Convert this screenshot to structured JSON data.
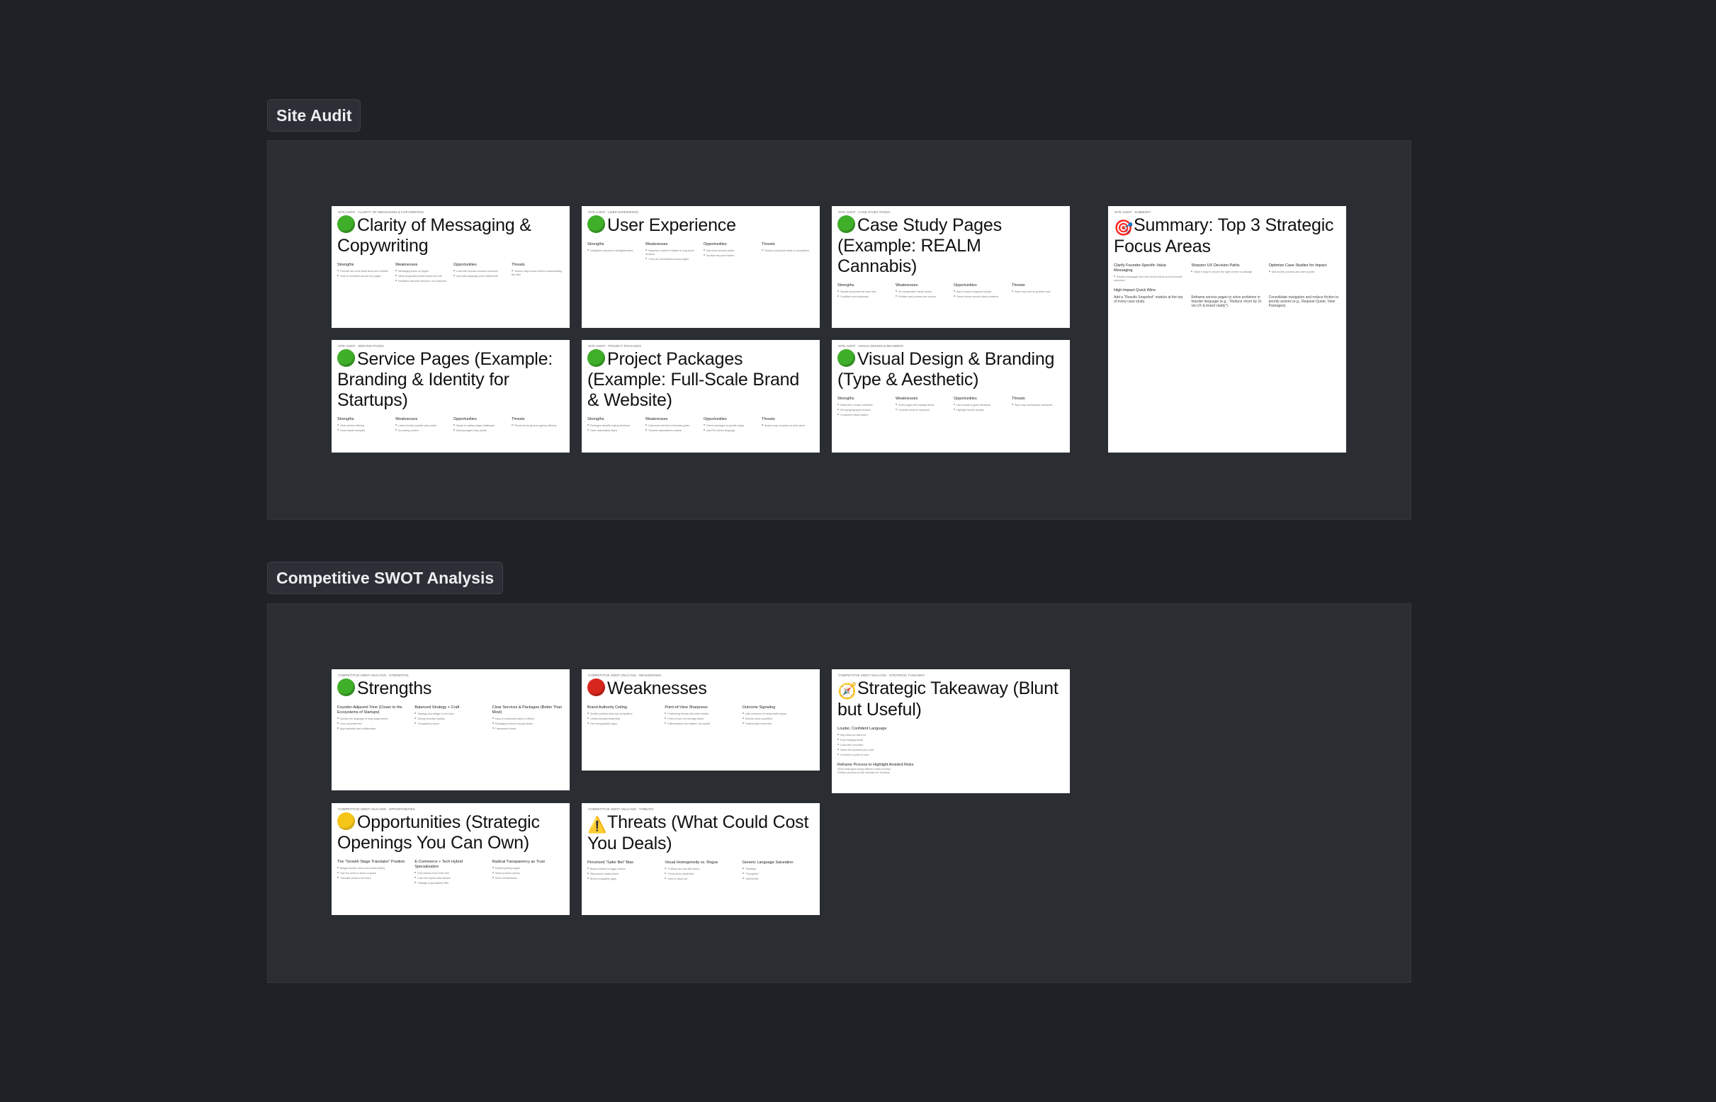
{
  "sections": [
    {
      "label": "Site Audit",
      "slides": [
        {
          "icon": "green-circle-icon",
          "emoji": "",
          "style": "green",
          "breadcrumb": "SITE AUDIT · CLARITY OF MESSAGING & COPYWRITING",
          "title": "Clarity of Messaging & Copywriting",
          "columns": [
            {
              "head": "Strengths",
              "lines": [
                "Founder-led voice feels direct and credible",
                "Tone is consistent across key pages"
              ]
            },
            {
              "head": "Weaknesses",
              "lines": [
                "Messaging leans on jargon",
                "Value proposition buried below the fold",
                "Headlines describe services, not outcomes"
              ]
            },
            {
              "head": "Opportunities",
              "lines": [
                "Lead with founder-focused outcomes",
                "Use plain-language proof statements"
              ]
            },
            {
              "head": "Threats",
              "lines": [
                "Visitors may bounce before understanding the offer"
              ]
            }
          ]
        },
        {
          "icon": "green-circle-icon",
          "emoji": "",
          "style": "green",
          "breadcrumb": "SITE AUDIT · USER EXPERIENCE",
          "title": "User Experience",
          "columns": [
            {
              "head": "Strengths",
              "lines": [
                "Navigation structure is straightforward"
              ]
            },
            {
              "head": "Weaknesses",
              "lines": [
                "Important content is hidden in long scroll sections",
                "CTAs are inconsistent across pages"
              ]
            },
            {
              "head": "Opportunities",
              "lines": [
                "Add clear decision paths",
                "Surface key proof earlier"
              ]
            },
            {
              "head": "Threats",
              "lines": [
                "Friction could push leads to competitors"
              ]
            }
          ]
        },
        {
          "icon": "green-circle-icon",
          "emoji": "",
          "style": "green",
          "breadcrumb": "SITE AUDIT · CASE STUDY PAGES",
          "title": "Case Study Pages (Example: REALM Cannabis)",
          "columns": [
            {
              "head": "Strengths",
              "lines": [
                "Visuals showcase the work well",
                "Credible brand examples"
              ]
            },
            {
              "head": "Weaknesses",
              "lines": [
                "No measurable results shown",
                "Problem and process are unclear"
              ]
            },
            {
              "head": "Opportunities",
              "lines": [
                "Add a results snapshot module",
                "Frame stories around client problems"
              ]
            },
            {
              "head": "Threats",
              "lines": [
                "Work may read as portfolio only"
              ]
            }
          ]
        },
        {
          "icon": "target-icon",
          "emoji": "🎯",
          "style": "plain",
          "breadcrumb": "SITE AUDIT · SUMMARY",
          "title": "Summary: Top 3 Strategic Focus Areas",
          "columns": [
            {
              "head": "Clarify Founder-Specific Value Messaging",
              "lines": [
                "Rewrite homepage hero and service intros around founder outcomes"
              ]
            },
            {
              "head": "Sharpen UX Decision Paths",
              "lines": [
                "Make it easy to choose the right service or package"
              ]
            },
            {
              "head": "Optimize Case Studies for Impact",
              "lines": [
                "Add results, process and client quotes"
              ]
            }
          ],
          "extra_head": "High-Impact Quick Wins",
          "quick_wins": [
            "Add a \"Results Snapshot\" module at the top of every case study.",
            "Reframe service pages to solve problems in founder language (e.g., \"Reduce churn by 2x via UX & brand clarity\").",
            "Consolidate navigation and reduce friction to priority actions (e.g., Request Quote, View Packages)."
          ]
        },
        {
          "icon": "green-circle-icon",
          "emoji": "",
          "style": "green",
          "breadcrumb": "SITE AUDIT · SERVICE PAGES",
          "title": "Service Pages (Example: Branding & Identity for Startups)",
          "columns": [
            {
              "head": "Strengths",
              "lines": [
                "Clear service offering",
                "Good visual examples"
              ]
            },
            {
              "head": "Weaknesses",
              "lines": [
                "Lacks founder-specific pain points",
                "No pricing context"
              ]
            },
            {
              "head": "Opportunities",
              "lines": [
                "Speak to startup stage challenges",
                "Add packaged entry points"
              ]
            },
            {
              "head": "Threats",
              "lines": [
                "Perceived as generic agency offering"
              ]
            }
          ]
        },
        {
          "icon": "green-circle-icon",
          "emoji": "",
          "style": "green",
          "breadcrumb": "SITE AUDIT · PROJECT PACKAGES",
          "title": "Project Packages (Example: Full-Scale Brand & Website)",
          "columns": [
            {
              "head": "Strengths",
              "lines": [
                "Packages simplify buying decisions",
                "Clear deliverables listed"
              ]
            },
            {
              "head": "Weaknesses",
              "lines": [
                "Outcomes not tied to business goals",
                "Timeline expectations unclear"
              ]
            },
            {
              "head": "Opportunities",
              "lines": [
                "Frame packages by growth stage",
                "Add ROI-driven language"
              ]
            },
            {
              "head": "Threats",
              "lines": [
                "Buyers may compare on price alone"
              ]
            }
          ]
        },
        {
          "icon": "green-circle-icon",
          "emoji": "",
          "style": "green",
          "breadcrumb": "SITE AUDIT · VISUAL DESIGN & BRANDING",
          "title": "Visual Design & Branding (Type & Aesthetic)",
          "columns": [
            {
              "head": "Strengths",
              "lines": [
                "Distinctive, modern aesthetic",
                "Strong typography choices",
                "Consistent visual system"
              ]
            },
            {
              "head": "Weaknesses",
              "lines": [
                "Some pages feel visually dense",
                "Contrast could be improved"
              ]
            },
            {
              "head": "Opportunities",
              "lines": [
                "Use visuals to guide decisions",
                "Highlight results visually"
              ]
            },
            {
              "head": "Threats",
              "lines": [
                "Style may overshadow substance"
              ]
            }
          ]
        }
      ]
    },
    {
      "label": "Competitive SWOT Analysis",
      "slides": [
        {
          "icon": "green-circle-icon",
          "emoji": "",
          "style": "green",
          "breadcrumb": "COMPETITIVE SWOT ANALYSIS · STRENGTHS",
          "title": "Strengths",
          "columns": [
            {
              "head": "Founder-Adjacent Tone (Closer to the Ecosystems of Startups)",
              "lines": [
                "Speaks the language of early-stage teams",
                "Less corporate feel",
                "Approachable and collaborative"
              ]
            },
            {
              "head": "Balanced Strategy + Craft",
              "lines": [
                "Strategy and design in one team",
                "Strong execution quality",
                "Thoughtful process"
              ]
            },
            {
              "head": "Clear Services & Packages (Better Than Most)",
              "lines": [
                "Easy to understand what is offered",
                "Packaging reduces buying friction",
                "Transparent scope"
              ]
            }
          ]
        },
        {
          "icon": "red-circle-icon",
          "emoji": "",
          "style": "red",
          "breadcrumb": "COMPETITIVE SWOT ANALYSIS · WEAKNESSES",
          "title": "Weaknesses",
          "columns": [
            {
              "head": "Brand Authority Ceiling",
              "lines": [
                "Smaller portfolio than top competitors",
                "Limited thought leadership",
                "Few recognizable logos"
              ]
            },
            {
              "head": "Point-of-View Sharpness",
              "lines": [
                "Positioning blends with other studios",
                "Point of view not strongly stated",
                "Differentiators are implied, not explicit"
              ]
            },
            {
              "head": "Outcome Signaling",
              "lines": [
                "Little evidence of measurable impact",
                "Results rarely quantified",
                "Testimonials underused"
              ]
            }
          ]
        },
        {
          "icon": "compass-icon",
          "emoji": "🧭",
          "style": "plain",
          "breadcrumb": "COMPETITIVE SWOT ANALYSIS · STRATEGIC TAKEAWAY",
          "title": "Strategic Takeaway (Blunt but Useful)",
          "columns": [
            {
              "head": "Louder, Confident Language",
              "lines": [
                "Say what you stand for",
                "Drop hedging words",
                "Lead with conviction",
                "Name the problems you solve",
                "Commit to a point of view"
              ]
            }
          ],
          "extra_head": "Reframe Process to Highlight Avoided Risks",
          "extra_lines": [
            "Show what goes wrong without a clear process",
            "Position process as risk reduction for founders"
          ]
        },
        {
          "icon": "yellow-circle-icon",
          "emoji": "",
          "style": "yellow",
          "breadcrumb": "COMPETITIVE SWOT ANALYSIS · OPPORTUNITIES",
          "title": "Opportunities (Strategic Openings You Can Own)",
          "columns": [
            {
              "head": "The \"Growth Stage Translator\" Position",
              "lines": [
                "Bridge founder vision and market clarity",
                "Own the seed-to-series-A space",
                "Translate product into story"
              ]
            },
            {
              "head": "E-Commerce + Tech Hybrid Specialization",
              "lines": [
                "Few studios cover both well",
                "Lean into hybrid case studies",
                "Package a specialized offer"
              ]
            },
            {
              "head": "Radical Transparency as Trust",
              "lines": [
                "Publish pricing ranges",
                "Share process openly",
                "Show real timelines"
              ]
            }
          ]
        },
        {
          "icon": "warning-icon",
          "emoji": "⚠️",
          "style": "plain",
          "breadcrumb": "COMPETITIVE SWOT ANALYSIS · THREATS",
          "title": "Threats (What Could Cost You Deals)",
          "columns": [
            {
              "head": "Perceived \"Safer Bet\" Bias",
              "lines": [
                "Buyers default to bigger names",
                "Risk-averse stakeholders",
                "Brand recognition gaps"
              ]
            },
            {
              "head": "Visual Homogeneity vs. Rogue",
              "lines": [
                "Portfolio can look like others",
                "Trend-driven aesthetics",
                "Hard to stand out"
              ]
            },
            {
              "head": "Generic Language Saturation",
              "lines": [
                "\"Strategic\"",
                "\"Thoughtful\"",
                "\"Intentional\""
              ]
            }
          ]
        }
      ]
    }
  ]
}
